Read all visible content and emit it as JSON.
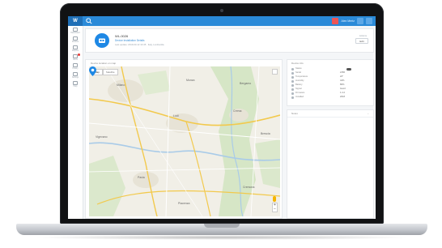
{
  "app": {
    "brand": "W",
    "user_name": "Alex Mertz"
  },
  "sidebar": {
    "items": [
      {
        "label": "Dashboard",
        "icon": "dashboard-icon"
      },
      {
        "label": "Devices",
        "icon": "devices-icon"
      },
      {
        "label": "Reports",
        "icon": "reports-icon"
      },
      {
        "label": "Alerts",
        "icon": "alerts-icon",
        "badge": true
      },
      {
        "label": "History",
        "icon": "history-icon"
      },
      {
        "label": "Settings",
        "icon": "settings-icon"
      },
      {
        "label": "Help",
        "icon": "help-icon"
      }
    ]
  },
  "device": {
    "name": "WL-0026",
    "subtitle": "Device Installation Details",
    "meta": "Last update: 2019-03-12 10:45 · Italy, Lombardia",
    "right_label": "Actions",
    "action_button": "Edit"
  },
  "map": {
    "title": "Device location on map",
    "tab_map": "Map",
    "tab_satellite": "Satellite",
    "zoom_in": "+",
    "zoom_out": "−",
    "place_labels": [
      "Milano",
      "Lodi",
      "Pavia",
      "Monza",
      "Bergamo",
      "Crema",
      "Cremona",
      "Vigevano",
      "Brescia",
      "Piacenza"
    ]
  },
  "info": {
    "title": "Device info",
    "rows": [
      {
        "key": "Status",
        "value": ""
      },
      {
        "key": "Serial",
        "value": "2156"
      },
      {
        "key": "Temperature",
        "value": "22°"
      },
      {
        "key": "Humidity",
        "value": "44%"
      },
      {
        "key": "Battery",
        "value": "86%"
      },
      {
        "key": "Signal",
        "value": "Good"
      },
      {
        "key": "Firmware",
        "value": "1.4.2"
      },
      {
        "key": "Installed",
        "value": "2018"
      }
    ]
  },
  "notes": {
    "title": "Notes"
  },
  "colors": {
    "accent": "#2a8ad8",
    "avatar": "#1e88e5",
    "alert": "#e53935"
  }
}
